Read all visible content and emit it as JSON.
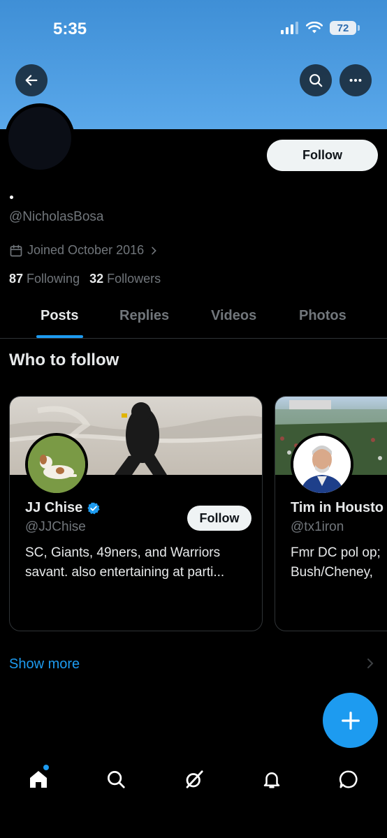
{
  "status_bar": {
    "time": "5:35",
    "battery": "72"
  },
  "header": {
    "back_icon": "arrow-left-icon",
    "search_icon": "search-icon",
    "more_icon": "ellipsis-icon"
  },
  "profile": {
    "display_name": "",
    "handle": "@NicholasBosa",
    "joined": "Joined October 2016",
    "following_count": "87",
    "following_label": "Following",
    "followers_count": "32",
    "followers_label": "Followers",
    "follow_label": "Follow"
  },
  "tabs": [
    {
      "label": "Posts",
      "active": true
    },
    {
      "label": "Replies",
      "active": false
    },
    {
      "label": "Videos",
      "active": false
    },
    {
      "label": "Photos",
      "active": false
    }
  ],
  "who_to_follow": {
    "title": "Who to follow",
    "cards": [
      {
        "name": "JJ Chise",
        "verified": true,
        "handle": "@JJChise",
        "bio": "SC, Giants, 49ners, and Warriors savant. also entertaining at parti...",
        "follow_label": "Follow"
      },
      {
        "name": "Tim in Housto",
        "verified": false,
        "handle": "@tx1iron",
        "bio_line1": "Fmr DC pol op;",
        "bio_line2": "Bush/Cheney,"
      }
    ],
    "show_more": "Show more"
  },
  "colors": {
    "accent": "#1d9bf0",
    "banner": "#4a9be0",
    "background": "#000000",
    "muted": "#71767b"
  },
  "bottom_nav": [
    "home-icon",
    "search-icon",
    "grok-icon",
    "bell-icon",
    "messages-icon"
  ]
}
